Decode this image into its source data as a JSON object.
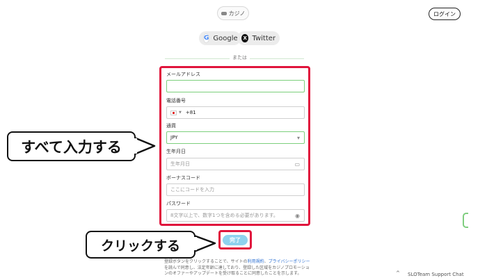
{
  "header": {
    "category_label": "カジノ",
    "login_label": "ログイン"
  },
  "social": {
    "google_label": "Google",
    "twitter_label": "Twitter",
    "google_icon": "google-icon",
    "twitter_icon": "x-icon"
  },
  "divider": {
    "or_label": "または"
  },
  "form": {
    "email": {
      "label": "メールアドレス",
      "value": "",
      "placeholder": ""
    },
    "phone": {
      "label": "電話番号",
      "dial_code": "+81",
      "value": ""
    },
    "currency": {
      "label": "通貨",
      "value": "JPY"
    },
    "birthdate": {
      "label": "生年月日",
      "placeholder": "生年月日"
    },
    "bonus_code": {
      "label": "ボーナスコード",
      "placeholder": "ここにコードを入力"
    },
    "password": {
      "label": "パスワード",
      "placeholder": "8文字以上で、数字1つを含める必要があります。"
    }
  },
  "callouts": {
    "fill_all": "すべて入力する",
    "click": "クリックする"
  },
  "submit_label": "完了",
  "terms": {
    "line1_prefix": "登録ボタンをクリックすることで、サイトの",
    "terms_link": "利用規約",
    "separator": "、",
    "privacy_link": "プライバシーポリシー",
    "line2": "を読んで同意し、法定年齢に達しており、登録した区域をカジノプロモーションのオファーやアップデートを受け取ることに同意したことを示します。"
  },
  "footer": {
    "support_label": "SLOTeam Support Chat",
    "chevron": "^"
  },
  "colors": {
    "highlight_red": "#e0143c",
    "field_green": "#7ccf7c",
    "submit_blue": "#8ed2ee",
    "link_blue": "#2a6ed1"
  }
}
